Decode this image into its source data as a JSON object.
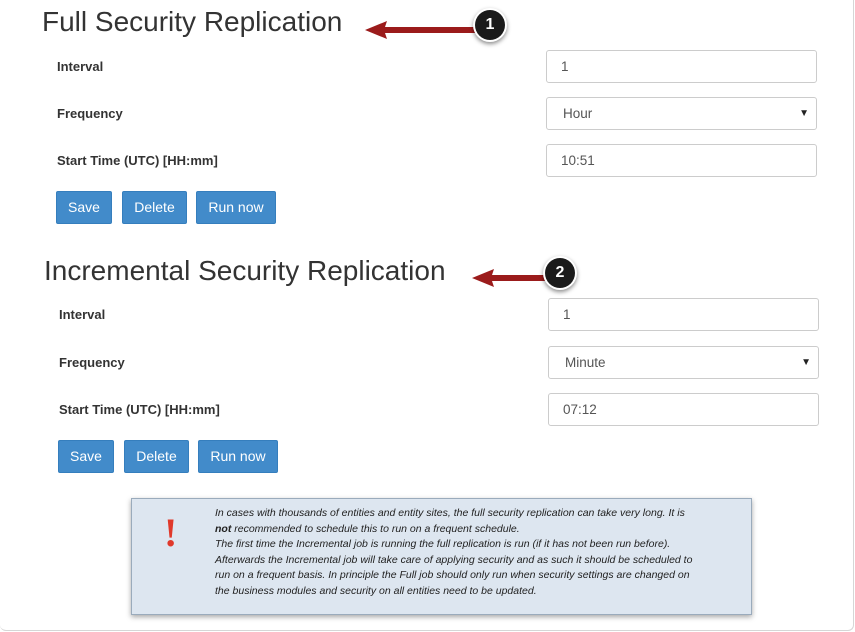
{
  "sections": [
    {
      "title": "Full Security Replication",
      "badge": "1",
      "interval_label": "Interval",
      "interval_value": "1",
      "frequency_label": "Frequency",
      "frequency_value": "Hour",
      "start_time_label": "Start Time (UTC) [HH:mm]",
      "start_time_value": "10:51",
      "save_label": "Save",
      "delete_label": "Delete",
      "run_now_label": "Run now"
    },
    {
      "title": "Incremental Security Replication",
      "badge": "2",
      "interval_label": "Interval",
      "interval_value": "1",
      "frequency_label": "Frequency",
      "frequency_value": "Minute",
      "start_time_label": "Start Time (UTC) [HH:mm]",
      "start_time_value": "07:12",
      "save_label": "Save",
      "delete_label": "Delete",
      "run_now_label": "Run now"
    }
  ],
  "note": {
    "icon": "!",
    "line1_a": "In cases with thousands of entities and entity sites, the full security replication can take very long. It is",
    "line2_bold": "not",
    "line2_rest": " recommended to schedule this to run on a frequent schedule.",
    "line3": "The first time the Incremental job is running the full replication is run (if it has not been run before).",
    "line4": "Afterwards the Incremental job will take care of applying security and as such it should be scheduled to",
    "line5": "run on a frequent basis. In principle the Full job should only run when security settings are changed on",
    "line6": "the business modules and security on all entities need to be updated."
  },
  "colors": {
    "button": "#428bca",
    "arrow": "#9b1b1b",
    "note_bg": "#dde6f0",
    "note_icon": "#e0392b"
  }
}
